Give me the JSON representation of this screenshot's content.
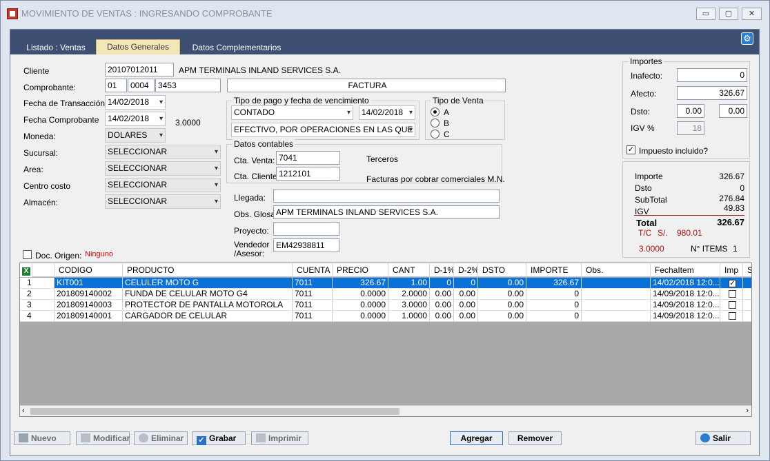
{
  "window": {
    "title": "MOVIMIENTO DE VENTAS : INGRESANDO COMPROBANTE",
    "minimize": "▭",
    "maximize": "▢",
    "close": "✕"
  },
  "tabs": [
    "Listado : Ventas",
    "Datos Generales",
    "Datos Complementarios"
  ],
  "form": {
    "cliente_label": "Cliente",
    "cliente_code": "20107012011",
    "cliente_name": "APM TERMINALS INLAND SERVICES S.A.",
    "comprobante_label": "Comprobante:",
    "comp_tipo": "01",
    "comp_serie": "0004",
    "comp_num": "3453",
    "comp_desc": "FACTURA",
    "fecha_trans_label": "Fecha de Transacción",
    "fecha_trans": "14/02/2018",
    "fecha_comp_label": "Fecha Comprobante",
    "fecha_comp": "14/02/2018",
    "tipo_cambio": "3.0000",
    "moneda_label": "Moneda:",
    "moneda": "DOLARES",
    "sucursal_label": "Sucursal:",
    "sucursal": "SELECCIONAR",
    "area_label": "Area:",
    "area": "SELECCIONAR",
    "centro_label": "Centro costo",
    "centro": "SELECCIONAR",
    "almacen_label": "Almacén:",
    "almacen": "SELECCIONAR",
    "pago_group": "Tipo de pago y fecha de vencimiento",
    "pago_tipo": "CONTADO",
    "pago_fecha": "14/02/2018",
    "pago_medio": "EFECTIVO, POR OPERACIONES EN LAS QUE NO",
    "tipo_venta_group": "Tipo de Venta",
    "tv_a": "A",
    "tv_b": "B",
    "tv_c": "C",
    "contables_group": "Datos contables",
    "cta_venta_label": "Cta. Venta:",
    "cta_venta": "7041",
    "cta_venta_desc": "Terceros",
    "cta_cliente_label": "Cta. Cliente:",
    "cta_cliente": "1212101",
    "cta_cliente_desc": "Facturas por cobrar comerciales M.N.",
    "llegada_label": "Llegada:",
    "llegada": "",
    "glosa_label": "Obs. Glosa:",
    "glosa": "APM TERMINALS INLAND SERVICES S.A.",
    "proyecto_label": "Proyecto:",
    "proyecto": "",
    "vendedor_label1": "Vendedor",
    "vendedor_label2": "/Asesor:",
    "vendedor": "EM42938811",
    "doc_origen_label": "Doc. Origen:",
    "doc_origen_value": "Ninguno"
  },
  "importes": {
    "group": "Importes",
    "inafecto_label": "Inafecto:",
    "inafecto": "0",
    "afecto_label": "Afecto:",
    "afecto": "326.67",
    "dsto_label": "Dsto:",
    "dsto1": "0.00",
    "dsto2": "0.00",
    "igv_label": "IGV %",
    "igv": "18",
    "impuesto_label": "Impuesto incluido?",
    "impuesto_checked": true
  },
  "totales": {
    "importe_label": "Importe",
    "importe": "326.67",
    "dsto_label": "Dsto",
    "dsto": "0",
    "subtotal_label": "SubTotal",
    "subtotal": "276.84",
    "igv_label": "IGV",
    "igv": "49.83",
    "total_label": "Total",
    "total": "326.67",
    "tc_label": "T/C",
    "tc_currency": "S/.",
    "tc_value": "980.01",
    "tipo_cambio": "3.0000",
    "items_label": "N° ITEMS",
    "items": "1"
  },
  "grid": {
    "headers": [
      "CODIGO",
      "PRODUCTO",
      "CUENTA",
      "PRECIO",
      "CANT",
      "D-1%",
      "D-2%",
      "DSTO",
      "IMPORTE",
      "Obs.",
      "FechaItem",
      "Imp",
      "S"
    ],
    "rows": [
      {
        "n": "1",
        "codigo": "KIT001",
        "producto": "CELULER MOTO G",
        "cuenta": "7011",
        "precio": "326.67",
        "cant": "1.00",
        "d1": "0",
        "d2": "0",
        "dsto": "0.00",
        "importe": "326.67",
        "obs": "",
        "fecha": "14/02/2018 12:0...",
        "imp": true
      },
      {
        "n": "2",
        "codigo": "201809140002",
        "producto": "FUNDA DE CELULAR MOTO G4",
        "cuenta": "7011",
        "precio": "0.0000",
        "cant": "2.0000",
        "d1": "0.00",
        "d2": "0.00",
        "dsto": "0.00",
        "importe": "0",
        "obs": "",
        "fecha": "14/09/2018 12:0...",
        "imp": false
      },
      {
        "n": "3",
        "codigo": "201809140003",
        "producto": "PROTECTOR DE PANTALLA MOTOROLA",
        "cuenta": "7011",
        "precio": "0.0000",
        "cant": "3.0000",
        "d1": "0.00",
        "d2": "0.00",
        "dsto": "0.00",
        "importe": "0",
        "obs": "",
        "fecha": "14/09/2018 12:0...",
        "imp": false
      },
      {
        "n": "4",
        "codigo": "201809140001",
        "producto": "CARGADOR DE CELULAR",
        "cuenta": "7011",
        "precio": "0.0000",
        "cant": "1.0000",
        "d1": "0.00",
        "d2": "0.00",
        "dsto": "0.00",
        "importe": "0",
        "obs": "",
        "fecha": "14/09/2018 12:0...",
        "imp": false
      }
    ]
  },
  "buttons": {
    "nuevo": "Nuevo",
    "modificar": "Modificar",
    "eliminar": "Eliminar",
    "grabar": "Grabar",
    "imprimir": "Imprimir",
    "agregar": "Agregar",
    "remover": "Remover",
    "salir": "Salir"
  }
}
